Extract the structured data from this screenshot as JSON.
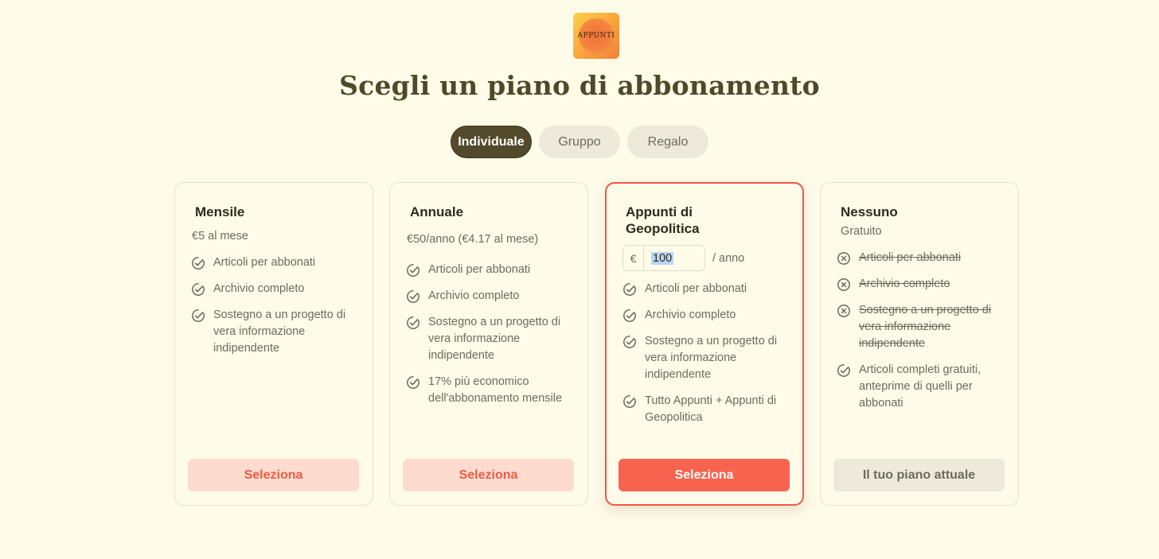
{
  "logo": {
    "text": "APPUNTI"
  },
  "page_title": "Scegli un piano di abbonamento",
  "tabs": [
    {
      "label": "Individuale",
      "active": true
    },
    {
      "label": "Gruppo",
      "active": false
    },
    {
      "label": "Regalo",
      "active": false
    }
  ],
  "plans": [
    {
      "title": "Mensile",
      "price": "€5 al mese",
      "features": [
        {
          "text": "Articoli per abbonati",
          "included": true
        },
        {
          "text": "Archivio completo",
          "included": true
        },
        {
          "text": "Sostegno a un progetto di vera informazione indipendente",
          "included": true
        }
      ],
      "button": "Seleziona"
    },
    {
      "title": "Annuale",
      "price": "€50/anno (€4.17 al mese)",
      "features": [
        {
          "text": "Articoli per abbonati",
          "included": true
        },
        {
          "text": "Archivio completo",
          "included": true
        },
        {
          "text": "Sostegno a un progetto di vera informazione indipendente",
          "included": true
        },
        {
          "text": "17% più economico dell'abbonamento mensile",
          "included": true
        }
      ],
      "button": "Seleziona"
    },
    {
      "title": "Appunti di Geopolitica",
      "amount": {
        "currency": "€",
        "value": "100",
        "unit": "/ anno"
      },
      "features": [
        {
          "text": "Articoli per abbonati",
          "included": true
        },
        {
          "text": "Archivio completo",
          "included": true
        },
        {
          "text": "Sostegno a un progetto di vera informazione indipendente",
          "included": true
        },
        {
          "text": "Tutto Appunti + Appunti di Geopolitica",
          "included": true
        }
      ],
      "button": "Seleziona"
    },
    {
      "title": "Nessuno",
      "price": "Gratuito",
      "features": [
        {
          "text": "Articoli per abbonati",
          "included": false
        },
        {
          "text": "Archivio completo",
          "included": false
        },
        {
          "text": "Sostegno a un progetto di vera informazione indipendente",
          "included": false
        },
        {
          "text": "Articoli completi gratuiti, anteprime di quelli per abbonati",
          "included": true
        }
      ],
      "button": "Il tuo piano attuale"
    }
  ],
  "colors": {
    "background": "#fefbe9",
    "accent": "#f7634f",
    "tab_active": "#524a2b",
    "selected_border": "#f0584a"
  }
}
